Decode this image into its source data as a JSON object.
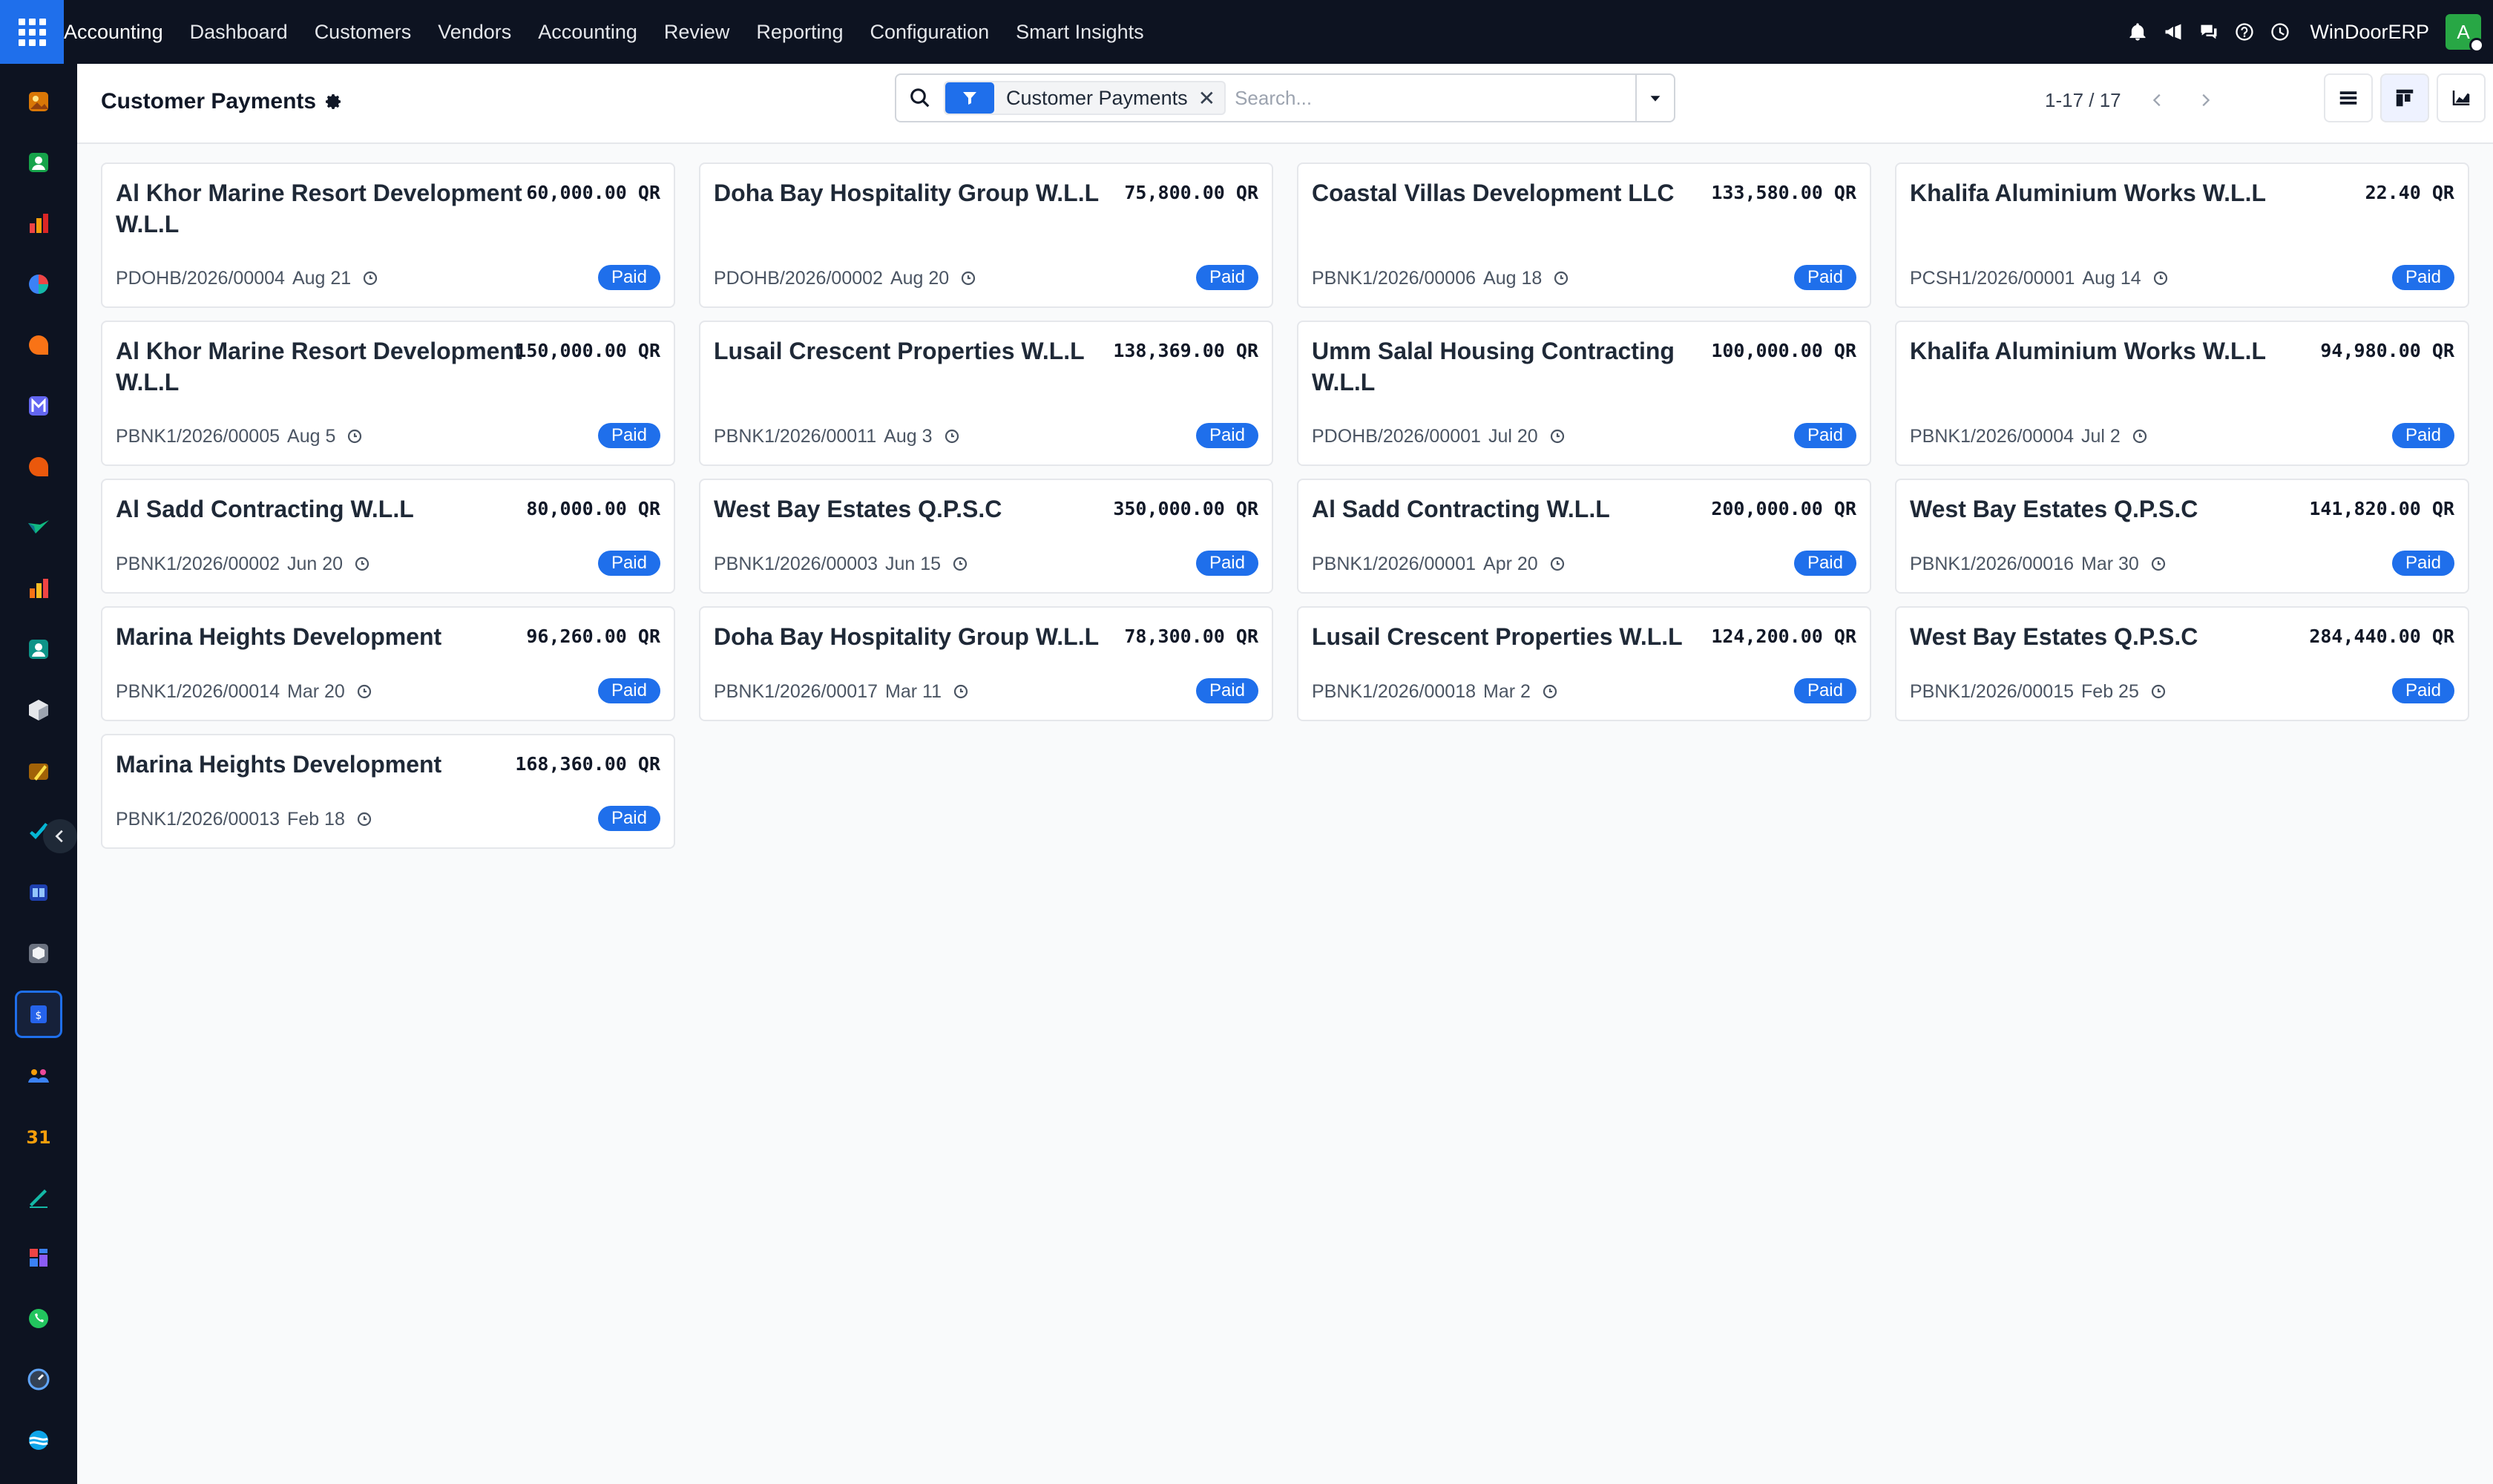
{
  "navbar": {
    "brand": "Accounting",
    "menu": [
      "Dashboard",
      "Customers",
      "Vendors",
      "Accounting",
      "Review",
      "Reporting",
      "Configuration",
      "Smart Insights"
    ],
    "company": "WinDoorERP",
    "avatar_letter": "A"
  },
  "control_panel": {
    "title": "Customer Payments",
    "search": {
      "facet_label": "Customer Payments",
      "placeholder": "Search..."
    },
    "pager": "1-17 / 17"
  },
  "cards": [
    {
      "name": "Al Khor Marine Resort Development W.L.L",
      "amount": "60,000.00 QR",
      "ref": "PDOHB/2026/00004",
      "date": "Aug 21",
      "status": "Paid"
    },
    {
      "name": "Doha Bay Hospitality Group W.L.L",
      "amount": "75,800.00 QR",
      "ref": "PDOHB/2026/00002",
      "date": "Aug 20",
      "status": "Paid"
    },
    {
      "name": "Coastal Villas Development LLC",
      "amount": "133,580.00 QR",
      "ref": "PBNK1/2026/00006",
      "date": "Aug 18",
      "status": "Paid"
    },
    {
      "name": "Khalifa Aluminium Works W.L.L",
      "amount": "22.40 QR",
      "ref": "PCSH1/2026/00001",
      "date": "Aug 14",
      "status": "Paid"
    },
    {
      "name": "Al Khor Marine Resort Development W.L.L",
      "amount": "150,000.00 QR",
      "ref": "PBNK1/2026/00005",
      "date": "Aug 5",
      "status": "Paid"
    },
    {
      "name": "Lusail Crescent Properties W.L.L",
      "amount": "138,369.00 QR",
      "ref": "PBNK1/2026/00011",
      "date": "Aug 3",
      "status": "Paid"
    },
    {
      "name": "Umm Salal Housing Contracting W.L.L",
      "amount": "100,000.00 QR",
      "ref": "PDOHB/2026/00001",
      "date": "Jul 20",
      "status": "Paid"
    },
    {
      "name": "Khalifa Aluminium Works W.L.L",
      "amount": "94,980.00 QR",
      "ref": "PBNK1/2026/00004",
      "date": "Jul 2",
      "status": "Paid"
    },
    {
      "name": "Al Sadd Contracting W.L.L",
      "amount": "80,000.00 QR",
      "ref": "PBNK1/2026/00002",
      "date": "Jun 20",
      "status": "Paid"
    },
    {
      "name": "West Bay Estates Q.P.S.C",
      "amount": "350,000.00 QR",
      "ref": "PBNK1/2026/00003",
      "date": "Jun 15",
      "status": "Paid"
    },
    {
      "name": "Al Sadd Contracting W.L.L",
      "amount": "200,000.00 QR",
      "ref": "PBNK1/2026/00001",
      "date": "Apr 20",
      "status": "Paid"
    },
    {
      "name": "West Bay Estates Q.P.S.C",
      "amount": "141,820.00 QR",
      "ref": "PBNK1/2026/00016",
      "date": "Mar 30",
      "status": "Paid"
    },
    {
      "name": "Marina Heights Development",
      "amount": "96,260.00 QR",
      "ref": "PBNK1/2026/00014",
      "date": "Mar 20",
      "status": "Paid"
    },
    {
      "name": "Doha Bay Hospitality Group W.L.L",
      "amount": "78,300.00 QR",
      "ref": "PBNK1/2026/00017",
      "date": "Mar 11",
      "status": "Paid"
    },
    {
      "name": "Lusail Crescent Properties W.L.L",
      "amount": "124,200.00 QR",
      "ref": "PBNK1/2026/00018",
      "date": "Mar 2",
      "status": "Paid"
    },
    {
      "name": "West Bay Estates Q.P.S.C",
      "amount": "284,440.00 QR",
      "ref": "PBNK1/2026/00015",
      "date": "Feb 25",
      "status": "Paid"
    },
    {
      "name": "Marina Heights Development",
      "amount": "168,360.00 QR",
      "ref": "PBNK1/2026/00013",
      "date": "Feb 18",
      "status": "Paid"
    }
  ],
  "colors": {
    "navbar_bg": "#0d1321",
    "accent": "#1f6feb",
    "paid_badge": "#1f6feb",
    "avatar_bg": "#28a745"
  },
  "icons": {
    "apps": "grid-icon",
    "tray": [
      "bell-icon",
      "megaphone-icon",
      "chat-icon",
      "help-icon",
      "clock-icon"
    ],
    "views": [
      "list-view-icon",
      "kanban-view-icon",
      "graph-view-icon",
      "activity-view-icon"
    ],
    "sidebar_apps": [
      "photo-app-icon",
      "contacts-app-icon",
      "charts-app-icon",
      "pie-app-icon",
      "chat-bubble-app-icon",
      "mail-app-icon",
      "discuss-app-icon",
      "check-app-icon",
      "reports-app-icon",
      "contacts2-app-icon",
      "package-app-icon",
      "brush-app-icon",
      "tasks-app-icon",
      "knowledge-app-icon",
      "inventory-app-icon",
      "accounting-app-icon",
      "employees-app-icon",
      "calendar-app-icon",
      "sign-app-icon",
      "dashboard-app-icon",
      "whatsapp-app-icon",
      "timer-app-icon",
      "website-app-icon"
    ]
  }
}
